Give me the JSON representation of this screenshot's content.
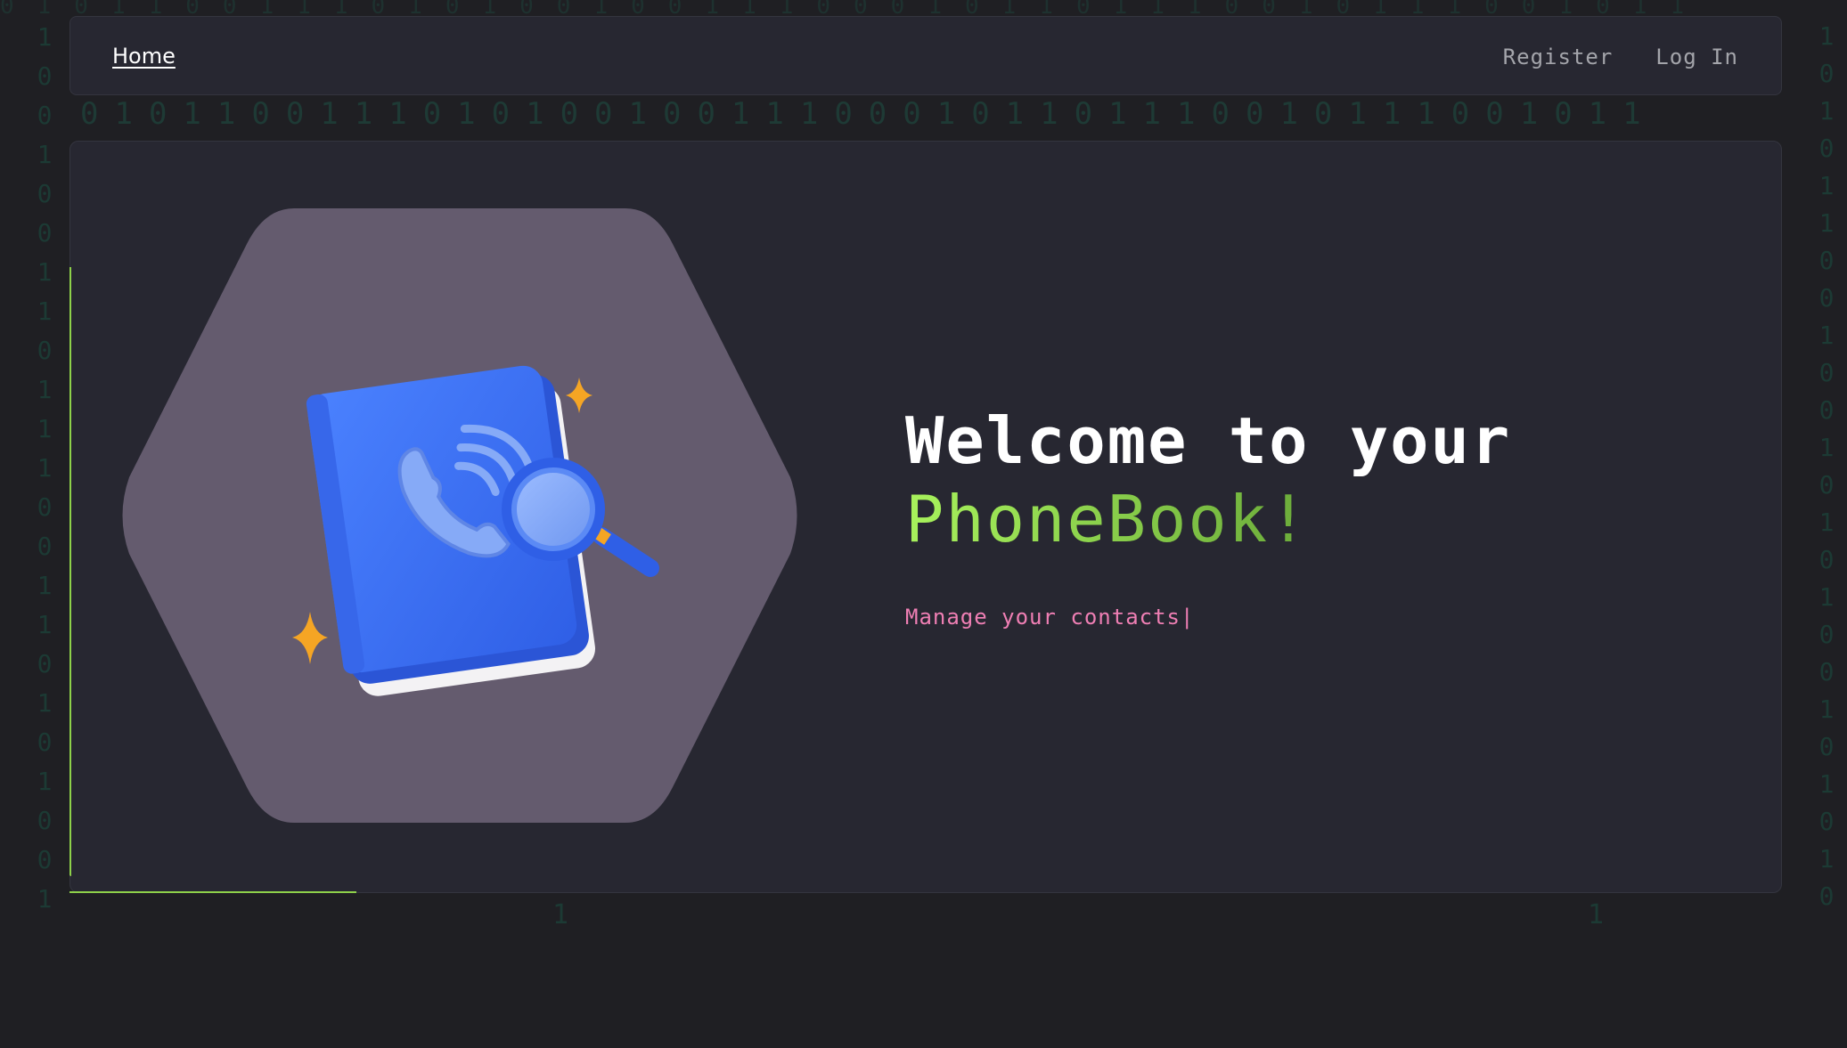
{
  "nav": {
    "home_label": "Home",
    "register_label": "Register",
    "login_label": "Log In"
  },
  "hero": {
    "headline_line1": "Welcome to your",
    "brand_name": "PhoneBook!",
    "tagline": "Manage your contacts",
    "cursor": "|",
    "illustration_icon": "phone-book-with-magnifier-icon"
  },
  "background": {
    "digits": "0101100111010100100111000101101110010111001011",
    "digit_color": "#1e3a35"
  },
  "colors": {
    "page_bg": "#1f1f23",
    "card_bg": "#272731",
    "accent_green": "#8ed14a",
    "brand_green_start": "#a8f25c",
    "brand_green_end": "#6bab3a",
    "tagline_pink": "#ef7fb4",
    "hexagon_fill": "#645b6e",
    "book_blue": "#3e73f4",
    "sparkle_orange": "#f5a524"
  }
}
